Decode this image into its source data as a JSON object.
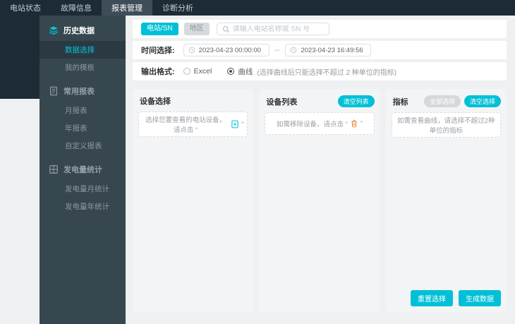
{
  "topnav": {
    "items": [
      {
        "label": "电站状态",
        "active": false
      },
      {
        "label": "故障信息",
        "active": false
      },
      {
        "label": "报表管理",
        "active": true
      },
      {
        "label": "诊断分析",
        "active": false
      }
    ]
  },
  "sidebar": {
    "groups": [
      {
        "icon": "layers-icon",
        "label": "历史数据",
        "items": [
          {
            "label": "数据选择",
            "active": true
          },
          {
            "label": "我的模板",
            "active": false
          }
        ]
      },
      {
        "icon": "report-icon",
        "label": "常用报表",
        "items": [
          {
            "label": "月报表",
            "active": false
          },
          {
            "label": "年报表",
            "active": false
          },
          {
            "label": "自定义报表",
            "active": false
          }
        ]
      },
      {
        "icon": "grid-icon",
        "label": "发电量统计",
        "items": [
          {
            "label": "发电量月统计",
            "active": false
          },
          {
            "label": "发电量年统计",
            "active": false
          }
        ]
      }
    ]
  },
  "filters": {
    "tabs": [
      {
        "label": "电站/SN",
        "active": true
      },
      {
        "label": "地区",
        "active": false
      }
    ],
    "search_placeholder": "请输入电站名称或 SN 号"
  },
  "time_row": {
    "label": "时间选择:",
    "start": "2023-04-23 00:00:00",
    "separator": "--",
    "end": "2023-04-23 16:49:56"
  },
  "format_row": {
    "label": "输出格式:",
    "options": [
      {
        "label": "Excel",
        "selected": false
      },
      {
        "label": "曲线",
        "selected": true
      }
    ],
    "hint": "(选择曲线后只能选择不超过 2 种单位的指标)"
  },
  "panels": {
    "device_select": {
      "title": "设备选择",
      "placeholder_prefix": "选择您要查看的电站设备，请点击 “",
      "placeholder_icon": "add-document-icon",
      "placeholder_suffix": "”"
    },
    "device_list": {
      "title": "设备列表",
      "clear_button": "清空列表",
      "placeholder_prefix": "如需移除设备，请点击 “",
      "placeholder_icon": "trash-icon",
      "placeholder_suffix": "”"
    },
    "indicators": {
      "title": "指标",
      "select_all_button": "全部选择",
      "clear_button": "清空选择",
      "placeholder": "如需查看曲线，请选择不超过2种单位的指标"
    }
  },
  "actions": {
    "reset": "重置选择",
    "generate": "生成数据"
  },
  "colors": {
    "accent": "#00c0d6",
    "nav_bg": "#1d2b36",
    "sidebar_bg": "#37474f",
    "sidebar_active_text": "#00c6dc",
    "trash_icon": "#f0832f"
  }
}
